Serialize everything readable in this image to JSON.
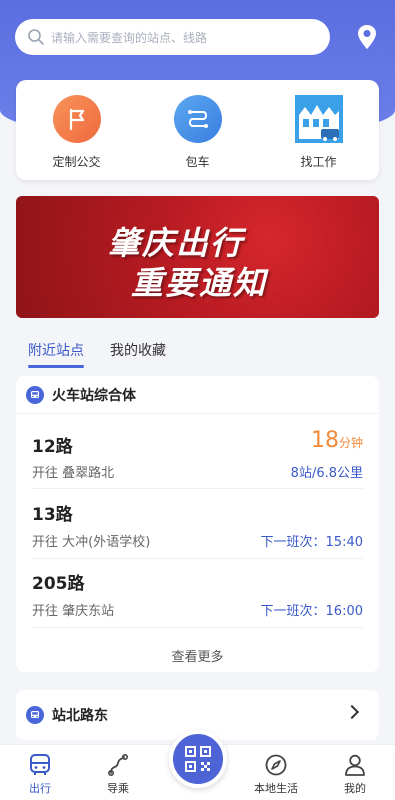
{
  "search": {
    "placeholder": "请输入需要查询的站点、线路"
  },
  "quick_links": [
    {
      "label": "定制公交",
      "icon": "flag-icon",
      "color": "#f47b4a"
    },
    {
      "label": "包车",
      "icon": "route-icon",
      "color": "#4a90e8"
    },
    {
      "label": "找工作",
      "icon": "city-building-icon",
      "color": "#3aa0e8"
    }
  ],
  "banner": {
    "line1": "肇庆出行",
    "line2": "重要通知"
  },
  "tabs": [
    {
      "label": "附近站点",
      "active": true
    },
    {
      "label": "我的收藏",
      "active": false
    }
  ],
  "stops": [
    {
      "name": "火车站综合体",
      "routes": [
        {
          "name": "12路",
          "direction": "开往 叠翠路北",
          "eta_value": "18",
          "eta_unit": "分钟",
          "detail": "8站/6.8公里"
        },
        {
          "name": "13路",
          "direction": "开往 大冲(外语学校)",
          "next_label": "下一班次：15:40"
        },
        {
          "name": "205路",
          "direction": "开往 肇庆东站",
          "next_label": "下一班次：16:00"
        }
      ],
      "more_label": "查看更多"
    },
    {
      "name": "站北路东"
    }
  ],
  "tabbar": [
    {
      "label": "出行",
      "icon": "bus-icon",
      "active": true
    },
    {
      "label": "导乘",
      "icon": "route-guide-icon",
      "active": false
    },
    {
      "label": "",
      "icon": "qr-code-icon",
      "active": false
    },
    {
      "label": "本地生活",
      "icon": "compass-icon",
      "active": false
    },
    {
      "label": "我的",
      "icon": "user-icon",
      "active": false
    }
  ],
  "colors": {
    "primary": "#4a66d8",
    "accent_orange": "#f28a3c",
    "banner_red": "#c21f26"
  }
}
